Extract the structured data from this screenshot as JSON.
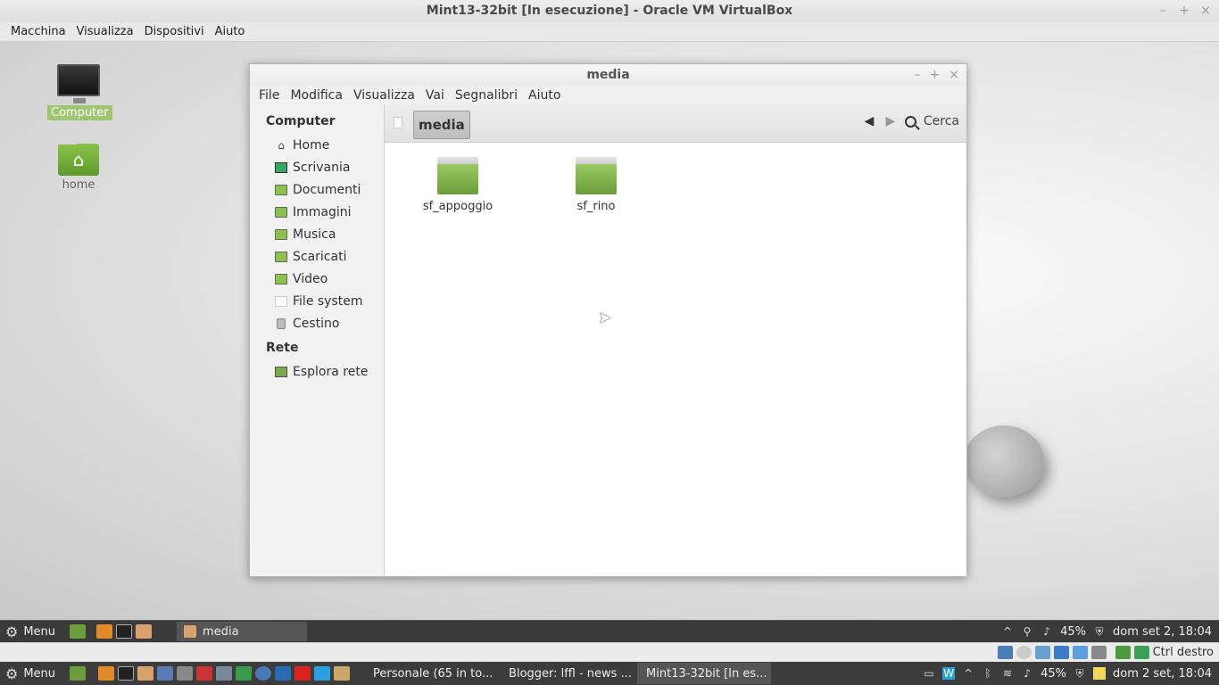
{
  "host": {
    "title": "Mint13-32bit [In esecuzione] - Oracle VM VirtualBox",
    "menu": [
      "Macchina",
      "Visualizza",
      "Dispositivi",
      "Aiuto"
    ],
    "status_key": "Ctrl destro"
  },
  "desktop": {
    "icons": [
      {
        "label": "Computer",
        "icon": "monitor-icon"
      },
      {
        "label": "home",
        "icon": "home-folder-icon"
      }
    ]
  },
  "file_manager": {
    "title": "media",
    "menu": [
      "File",
      "Modifica",
      "Visualizza",
      "Vai",
      "Segnalibri",
      "Aiuto"
    ],
    "sidebar": {
      "computer_heading": "Computer",
      "computer_items": [
        {
          "label": "Home",
          "icon": "home-icon"
        },
        {
          "label": "Scrivania",
          "icon": "desktop-icon"
        },
        {
          "label": "Documenti",
          "icon": "documents-folder-icon"
        },
        {
          "label": "Immagini",
          "icon": "pictures-folder-icon"
        },
        {
          "label": "Musica",
          "icon": "music-folder-icon"
        },
        {
          "label": "Scaricati",
          "icon": "downloads-folder-icon"
        },
        {
          "label": "Video",
          "icon": "videos-folder-icon"
        },
        {
          "label": "File system",
          "icon": "drive-icon"
        },
        {
          "label": "Cestino",
          "icon": "trash-icon"
        }
      ],
      "network_heading": "Rete",
      "network_items": [
        {
          "label": "Esplora rete",
          "icon": "network-icon"
        }
      ]
    },
    "path": "media",
    "search_label": "Cerca",
    "folders": [
      {
        "name": "sf_appoggio"
      },
      {
        "name": "sf_rino"
      }
    ]
  },
  "guest_panel": {
    "menu_label": "Menu",
    "task": "media",
    "battery": "45%",
    "clock": "dom set  2, 18:04"
  },
  "host_panel": {
    "menu_label": "Menu",
    "tasks": [
      "Personale (65 in to...",
      "Blogger: lffl - news ...",
      "Mint13-32bit [In es..."
    ],
    "battery": "45%",
    "clock": "dom  2 set, 18:04"
  }
}
